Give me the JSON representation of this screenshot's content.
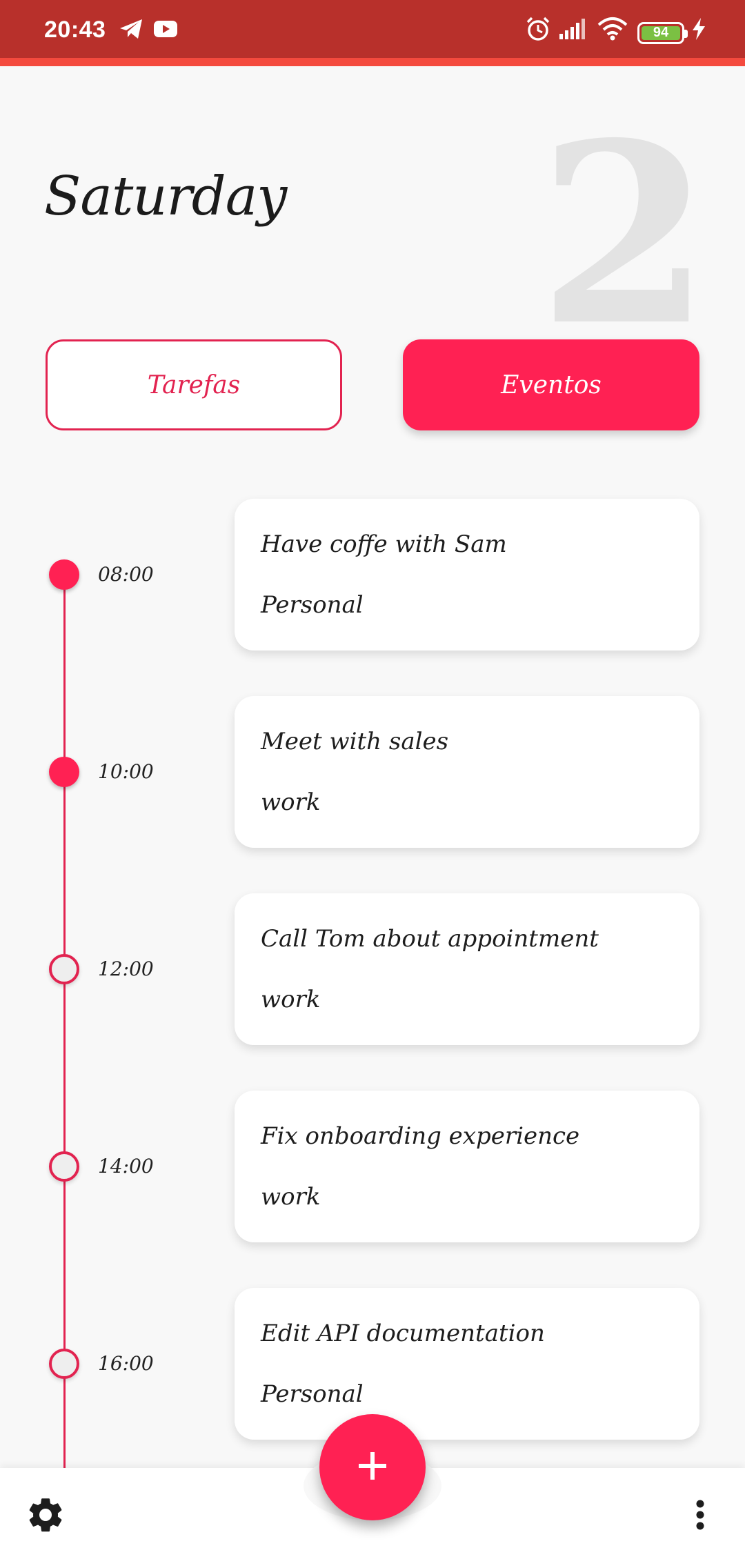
{
  "status_bar": {
    "time": "20:43",
    "battery_level": "94",
    "icons": [
      "telegram-icon",
      "youtube-icon",
      "alarm-icon",
      "signal-icon",
      "wifi-icon",
      "battery-icon",
      "charging-icon"
    ]
  },
  "header": {
    "day_name": "Saturday",
    "day_number": "2"
  },
  "tabs": {
    "tasks_label": "Tarefas",
    "events_label": "Eventos",
    "active": "events"
  },
  "events": [
    {
      "time": "08:00",
      "title": "Have coffe with Sam",
      "category": "Personal",
      "done": true
    },
    {
      "time": "10:00",
      "title": "Meet with sales",
      "category": "work",
      "done": true
    },
    {
      "time": "12:00",
      "title": "Call Tom about appointment",
      "category": "work",
      "done": false
    },
    {
      "time": "14:00",
      "title": "Fix onboarding experience",
      "category": "work",
      "done": false
    },
    {
      "time": "16:00",
      "title": "Edit API documentation",
      "category": "Personal",
      "done": false
    }
  ],
  "bottom_bar": {
    "settings_icon": "gear-icon",
    "add_icon": "plus-icon",
    "menu_icon": "more-vertical-icon"
  },
  "colors": {
    "accent": "#ff2153",
    "status_bar": "#b8302b",
    "background": "#f8f8f8"
  }
}
